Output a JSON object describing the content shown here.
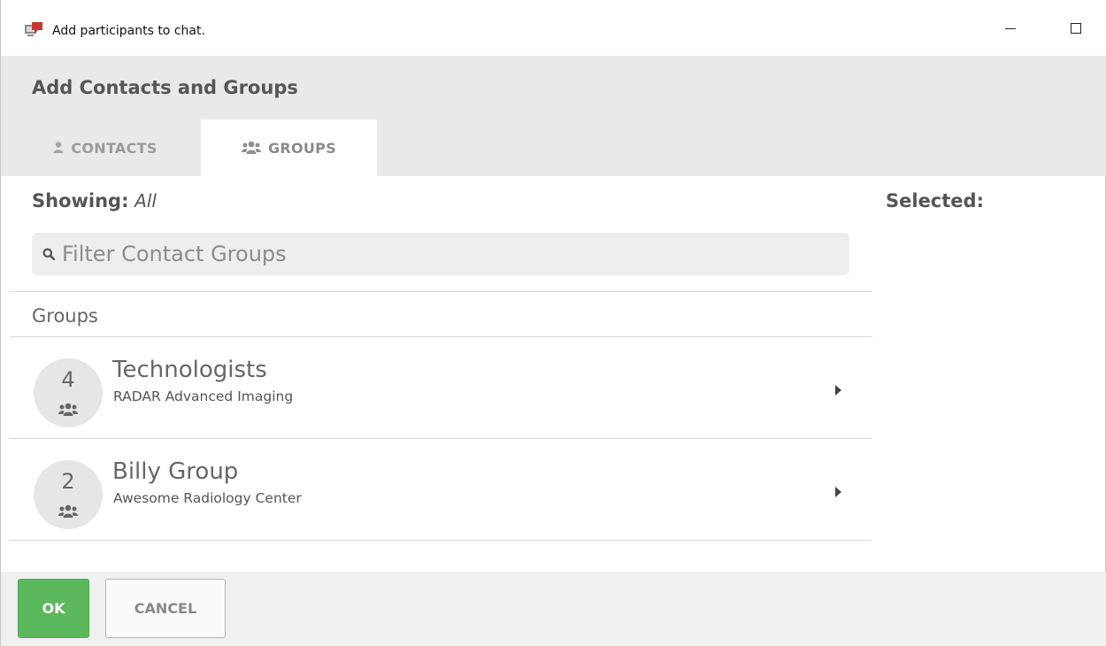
{
  "window": {
    "title": "Add participants to chat.",
    "icon": "chat-app-icon"
  },
  "header": {
    "title": "Add Contacts and Groups"
  },
  "tabs": [
    {
      "label": "CONTACTS",
      "icon": "user-icon",
      "active": false
    },
    {
      "label": "GROUPS",
      "icon": "users-icon",
      "active": true
    }
  ],
  "filter": {
    "showing_label": "Showing:",
    "showing_value": "All",
    "placeholder": "Filter Contact Groups"
  },
  "groups": {
    "heading": "Groups",
    "items": [
      {
        "count": "4",
        "name": "Technologists",
        "org": "RADAR Advanced Imaging"
      },
      {
        "count": "2",
        "name": "Billy Group",
        "org": "Awesome Radiology Center"
      }
    ]
  },
  "selected": {
    "label": "Selected:"
  },
  "footer": {
    "ok_label": "OK",
    "cancel_label": "CANCEL"
  },
  "colors": {
    "ok_button": "#5cb85c",
    "header_bg": "#e9e9e9",
    "app_icon": "#c0392b"
  }
}
